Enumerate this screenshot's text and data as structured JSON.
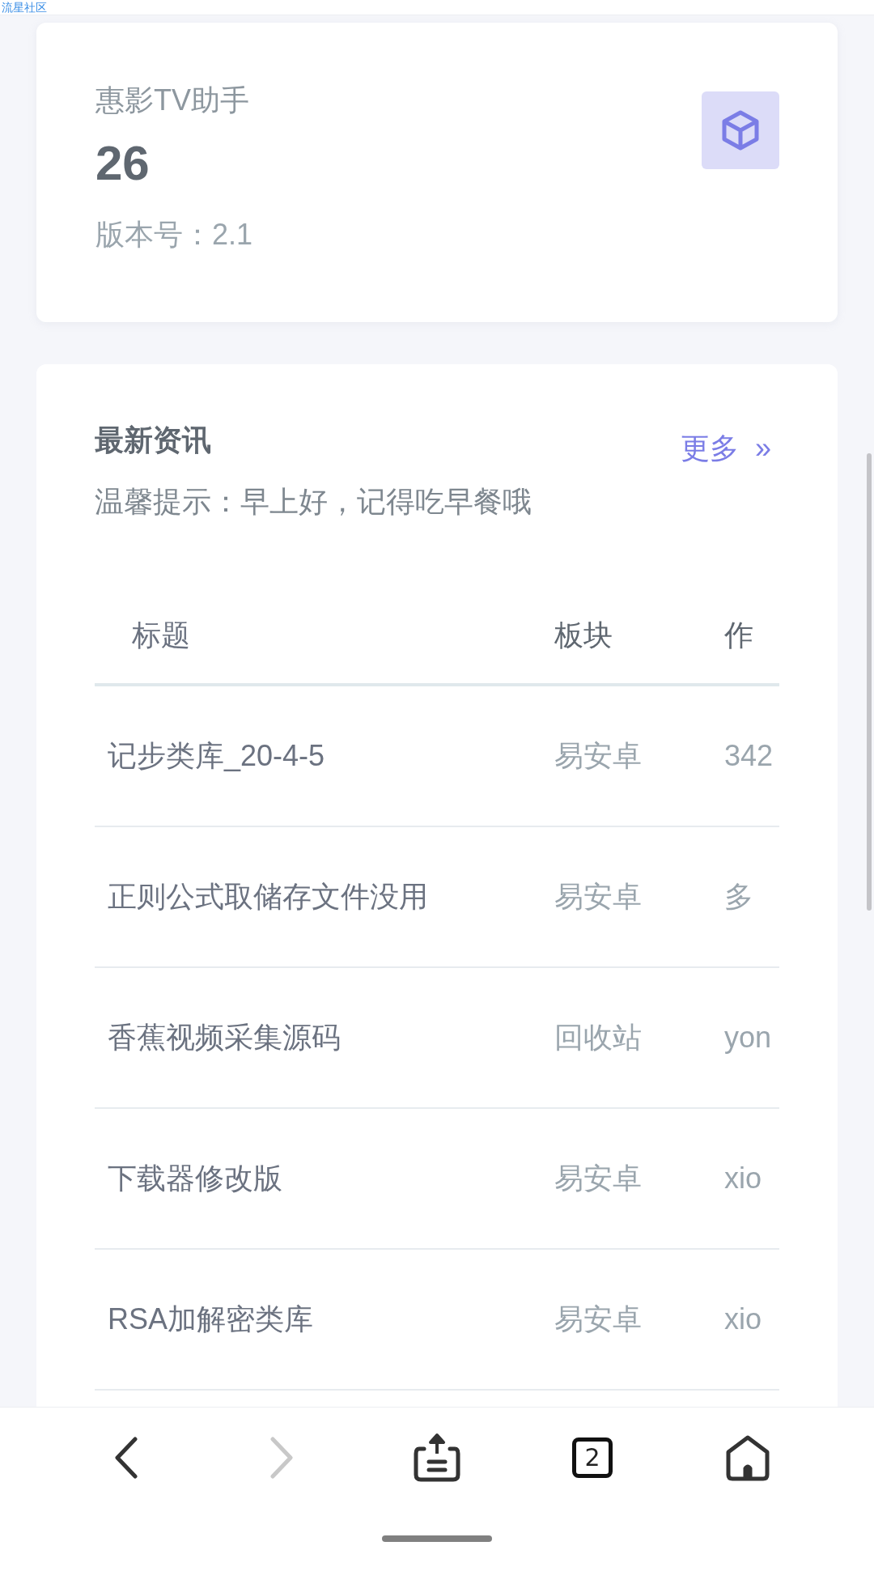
{
  "site_label": "流星社区",
  "app_card": {
    "name": "惠影TV助手",
    "count": "26",
    "version": "版本号：2.1"
  },
  "news": {
    "title": "最新资讯",
    "more": "更多",
    "more_icon": "»",
    "hint": "温馨提示：早上好，记得吃早餐哦",
    "columns": [
      "标题",
      "板块",
      "作"
    ],
    "rows": [
      {
        "title": "记步类库_20-4-5",
        "section": "易安卓",
        "author": "342"
      },
      {
        "title": "正则公式取储存文件没用",
        "section": "易安卓",
        "author": "多"
      },
      {
        "title": "香蕉视频采集源码",
        "section": "回收站",
        "author": "yon"
      },
      {
        "title": "下载器修改版",
        "section": "易安卓",
        "author": "xio"
      },
      {
        "title": "RSA加解密类库",
        "section": "易安卓",
        "author": "xio"
      }
    ]
  },
  "browser_bar": {
    "back_disabled": false,
    "forward_disabled": true,
    "tab_count": "2"
  }
}
